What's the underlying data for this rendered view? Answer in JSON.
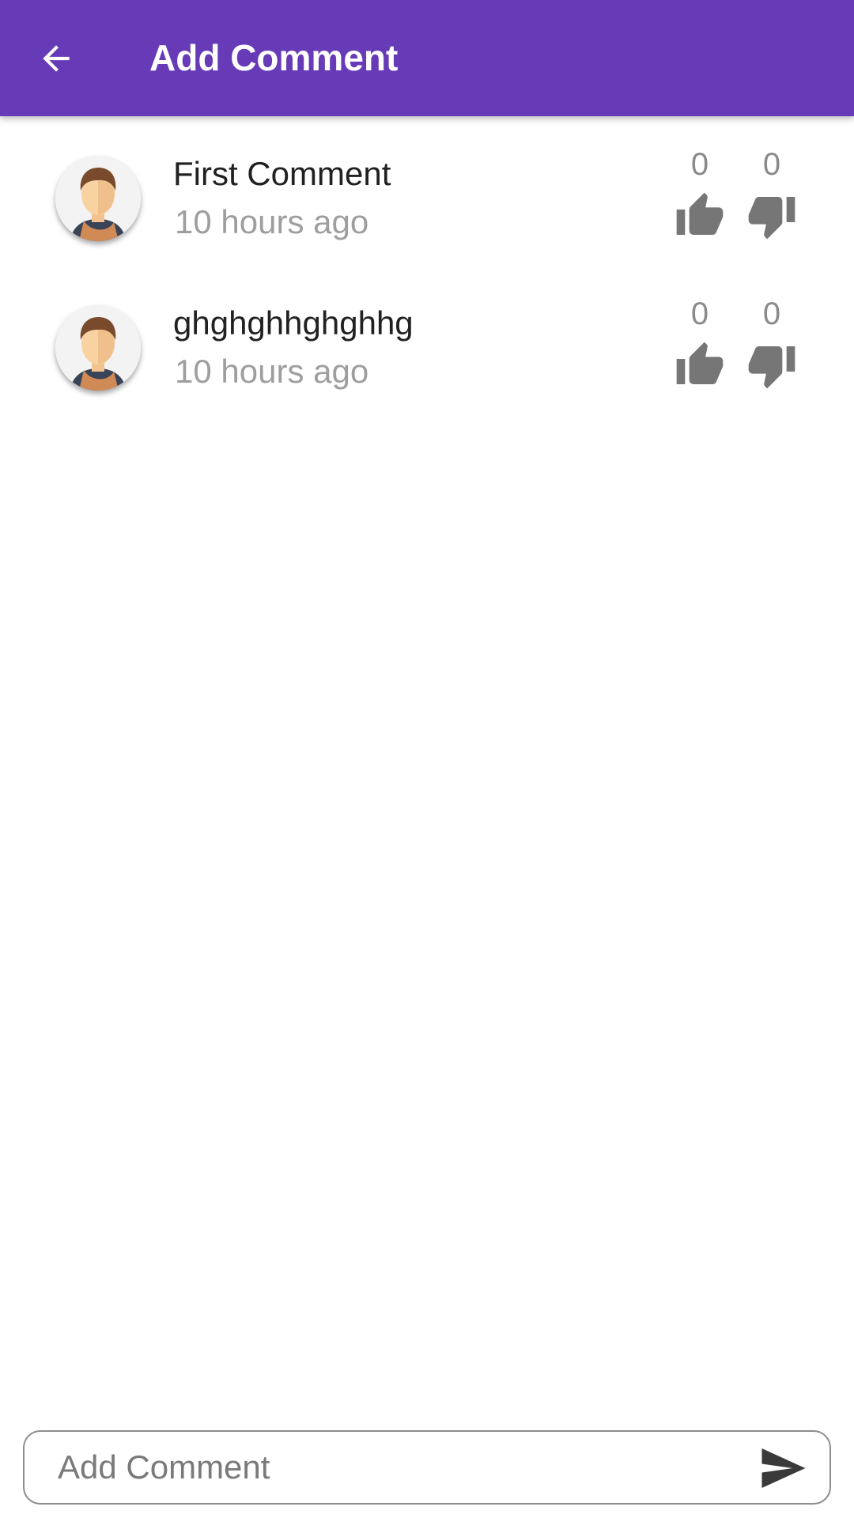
{
  "app_bar": {
    "title": "Add Comment",
    "color": "#673ab7",
    "back_icon": "arrow-back-icon"
  },
  "comments": [
    {
      "text": "First Comment",
      "time": "10 hours ago",
      "likes": "0",
      "dislikes": "0",
      "avatar_icon": "user-avatar-icon"
    },
    {
      "text": "ghghghhghghhg",
      "time": "10 hours ago",
      "likes": "0",
      "dislikes": "0",
      "avatar_icon": "user-avatar-icon"
    }
  ],
  "composer": {
    "placeholder": "Add Comment",
    "value": "",
    "send_icon": "send-icon"
  }
}
